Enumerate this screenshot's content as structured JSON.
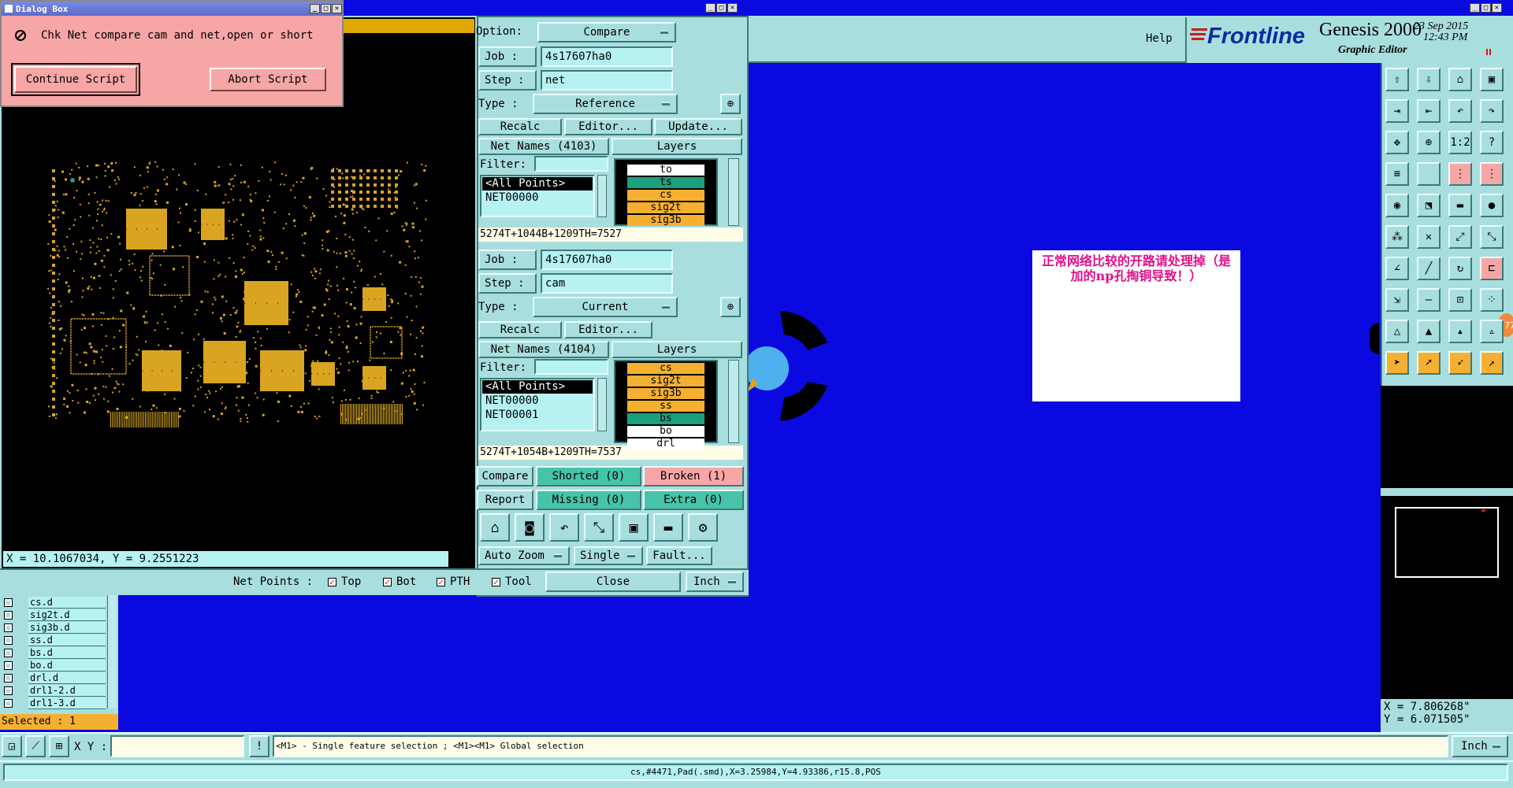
{
  "dialog": {
    "title": "Dialog Box",
    "message": "Chk Net compare cam and net,open or short",
    "continue_label": "Continue Script",
    "abort_label": "Abort Script"
  },
  "preview": {
    "coords": "X = 10.1067034, Y = 9.2551223"
  },
  "netcompare": {
    "option_label": "Option:",
    "option_value": "Compare",
    "ref": {
      "job_label": "Job  :",
      "job_value": "4s17607ha0",
      "step_label": "Step :",
      "step_value": "net",
      "type_label": "Type  :",
      "type_value": "Reference",
      "recalc": "Recalc",
      "editor": "Editor...",
      "update": "Update...",
      "netnames": "Net Names (4103)",
      "layers_header": "Layers",
      "filter_label": "Filter:",
      "nets": [
        "<All Points>",
        "NET00000"
      ],
      "layers": [
        "to",
        "ts",
        "cs",
        "sig2t",
        "sig3b"
      ],
      "summary": "5274T+1044B+1209TH=7527"
    },
    "cur": {
      "job_label": "Job  :",
      "job_value": "4s17607ha0",
      "step_label": "Step :",
      "step_value": "cam",
      "type_label": "Type  :",
      "type_value": "Current",
      "recalc": "Recalc",
      "editor": "Editor...",
      "netnames": "Net Names (4104)",
      "layers_header": "Layers",
      "filter_label": "Filter:",
      "nets": [
        "<All Points>",
        "NET00000",
        "NET00001"
      ],
      "layers": [
        "cs",
        "sig2t",
        "sig3b",
        "ss",
        "bs",
        "bo",
        "drl"
      ],
      "summary": "5274T+1054B+1209TH=7537"
    },
    "compare": "Compare",
    "shorted": "Shorted (0)",
    "broken": "Broken (1)",
    "report": "Report",
    "missing": "Missing (0)",
    "extra": "Extra (0)",
    "autozoom": "Auto Zoom",
    "single": "Single",
    "fault": "Fault...",
    "netpoints_label": "Net Points :",
    "np_top": "Top",
    "np_bot": "Bot",
    "np_pth": "PTH",
    "np_tool": "Tool",
    "close": "Close",
    "units": "Inch"
  },
  "header": {
    "help": "Help",
    "brand": "Frontline",
    "product": "Genesis 2000",
    "subtitle": "Graphic Editor",
    "date": "23 Sep 2015",
    "time": "12:43 PM"
  },
  "annotation": {
    "text": "正常网络比较的开路请处理掉（是加的np孔掏铜导致！）"
  },
  "layerlist": {
    "items": [
      "cs.d",
      "sig2t.d",
      "sig3b.d",
      "ss.d",
      "bs.d",
      "bo.d",
      "drl.d",
      "drl1-2.d",
      "drl1-3.d"
    ],
    "selected": "Selected : 1"
  },
  "coords_right": {
    "x": "X = 7.806268\"",
    "y": "Y = 6.071505\""
  },
  "bottom": {
    "xy_label": "X Y :",
    "hint": "<M1> - Single feature selection ; <M1><M1> Global selection",
    "units": "Inch",
    "status": "cs,#4471,Pad(.smd),X=3.25984,Y=4.93386,r15.8,POS"
  },
  "colors": {
    "canvas": "#0a0ae0",
    "panel": "#a9dede",
    "dialog": "#f7a6a6",
    "copper": "#d9a520",
    "layer_orange": "#f5b031",
    "layer_green": "#1aa07a"
  }
}
